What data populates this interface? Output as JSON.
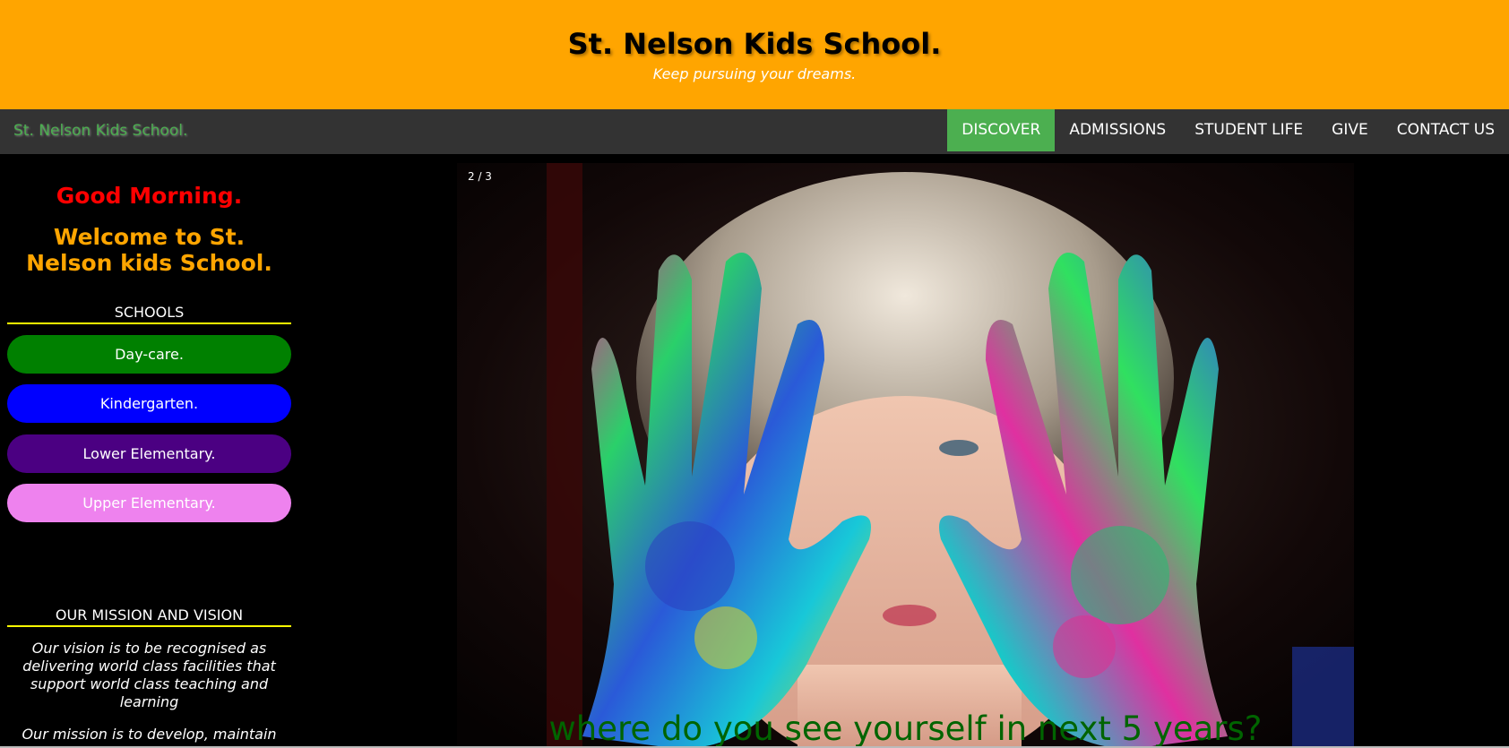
{
  "header": {
    "title": "St. Nelson Kids School.",
    "tagline": "Keep pursuing your dreams."
  },
  "nav": {
    "brand": "St. Nelson Kids School.",
    "items": [
      {
        "label": "DISCOVER",
        "active": true
      },
      {
        "label": "ADMISSIONS",
        "active": false
      },
      {
        "label": "STUDENT LIFE",
        "active": false
      },
      {
        "label": "GIVE",
        "active": false
      },
      {
        "label": "CONTACT US",
        "active": false
      }
    ]
  },
  "sidebar": {
    "greeting": "Good Morning.",
    "welcome": "Welcome to St. Nelson kids School.",
    "schools_title": "SCHOOLS",
    "schools": [
      {
        "label": "Day-care.",
        "color": "#008000"
      },
      {
        "label": "Kindergarten.",
        "color": "#0000ff"
      },
      {
        "label": "Lower Elementary.",
        "color": "#4b0082"
      },
      {
        "label": "Upper Elementary.",
        "color": "#ee82ee"
      }
    ],
    "mission_title": "OUR MISSION AND VISION",
    "vision_text": "Our vision is to be recognised as delivering world class facilities that support world class teaching and learning",
    "mission_text": "Our mission is to develop, maintain and promote the School's use of"
  },
  "slideshow": {
    "counter": "2 / 3",
    "caption": "where do you see yourself in next 5 years?",
    "image": "child-with-painted-hands"
  },
  "colors": {
    "header_bg": "#ffa500",
    "nav_bg": "#333333",
    "nav_active": "#4caf50",
    "greeting": "#ff0000",
    "welcome": "#ffa500",
    "caption": "#006400"
  }
}
